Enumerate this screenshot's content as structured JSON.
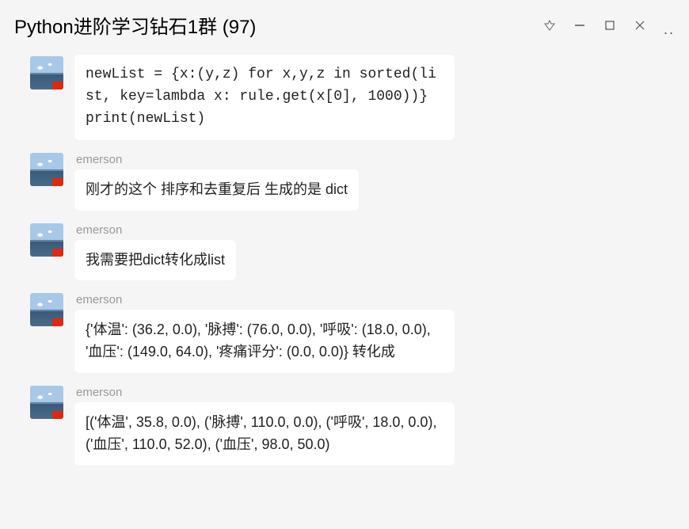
{
  "window": {
    "title": "Python进阶学习钻石1群 (97)"
  },
  "messages": [
    {
      "sender": null,
      "text": "newList = {x:(y,z) for x,y,z in sorted(list, key=lambda x: rule.get(x[0], 1000))}\nprint(newList)"
    },
    {
      "sender": "emerson",
      "text": "刚才的这个 排序和去重复后 生成的是 dict"
    },
    {
      "sender": "emerson",
      "text": "我需要把dict转化成list"
    },
    {
      "sender": "emerson",
      "text": "{'体温': (36.2, 0.0), '脉搏': (76.0, 0.0), '呼吸': (18.0, 0.0), '血压': (149.0, 64.0), '疼痛评分': (0.0, 0.0)}  转化成"
    },
    {
      "sender": "emerson",
      "text": " [('体温', 35.8, 0.0), ('脉搏', 110.0, 0.0), ('呼吸', 18.0, 0.0), ('血压', 110.0, 52.0), ('血压', 98.0, 50.0)"
    }
  ]
}
